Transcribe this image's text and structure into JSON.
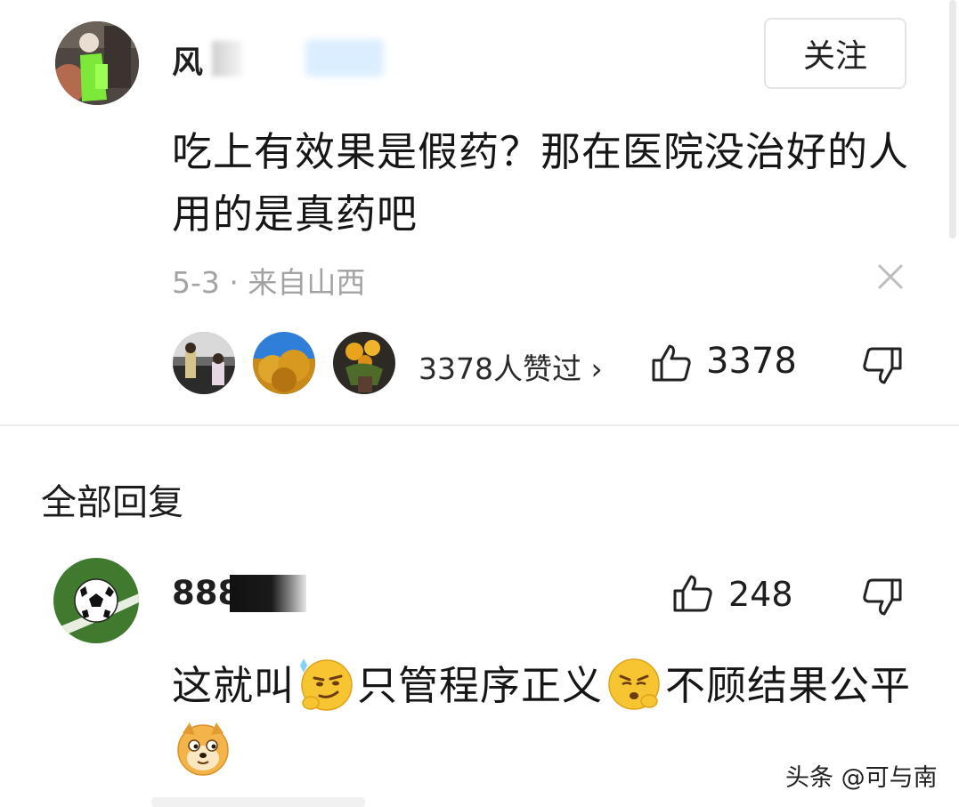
{
  "comment": {
    "username": "风",
    "follow_label": "关注",
    "text": "吃上有效果是假药？那在医院没治好的人用的是真药吧",
    "meta": "5-3 · 来自山西",
    "liked_by_text": "3378人赞过 ›",
    "like_count": "3378"
  },
  "replies_section": {
    "title": "全部回复"
  },
  "reply": {
    "username": "888",
    "like_count": "248",
    "text_part1": "这就叫",
    "text_part2": "只管程序正义",
    "text_part3": "不顾结果公平",
    "emoji_1": "smirk-face-icon",
    "emoji_2": "pouting-face-icon",
    "emoji_3": "doge-icon"
  },
  "watermark": "头条 @可与南",
  "colors": {
    "meta_gray": "#a3a3a3",
    "text": "#161616",
    "divider": "#ebebeb"
  }
}
